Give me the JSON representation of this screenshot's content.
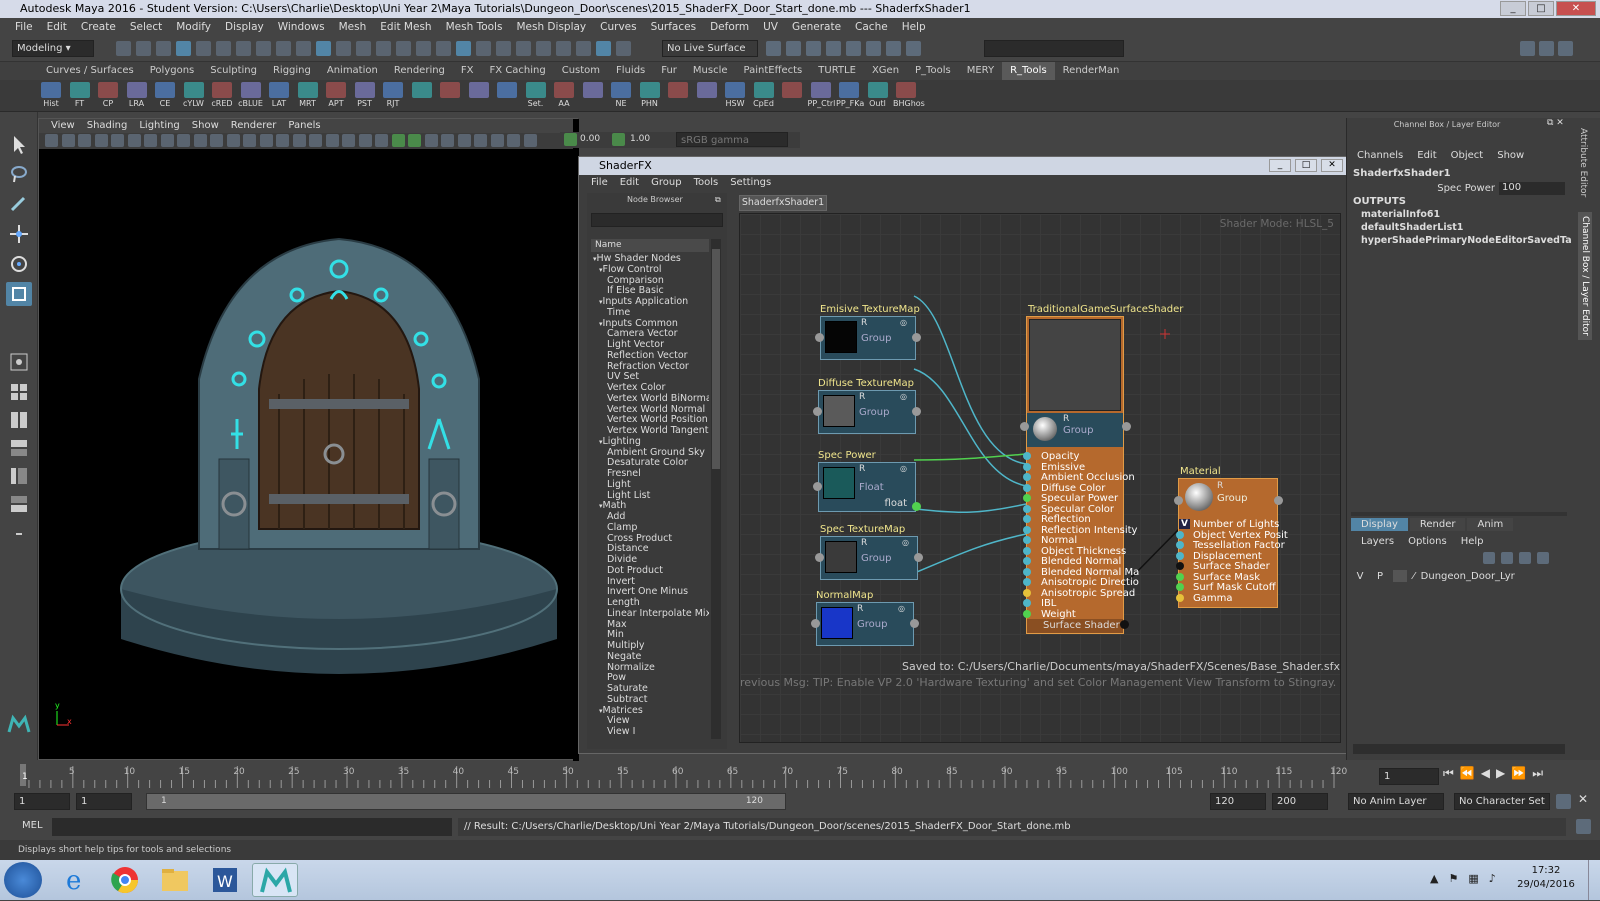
{
  "window": {
    "title": "Autodesk Maya 2016 - Student Version: C:\\Users\\Charlie\\Desktop\\Uni Year 2\\Maya Tutorials\\Dungeon_Door\\scenes\\2015_ShaderFX_Door_Start_done.mb    ---    ShaderfxShader1"
  },
  "menubar": [
    "File",
    "Edit",
    "Create",
    "Select",
    "Modify",
    "Display",
    "Windows",
    "Mesh",
    "Edit Mesh",
    "Mesh Tools",
    "Mesh Display",
    "Curves",
    "Surfaces",
    "Deform",
    "UV",
    "Generate",
    "Cache",
    "Help"
  ],
  "statusline": {
    "menuset": "Modeling",
    "live_surface": "No Live Surface"
  },
  "shelf_tabs": [
    "Curves / Surfaces",
    "Polygons",
    "Sculpting",
    "Rigging",
    "Animation",
    "Rendering",
    "FX",
    "FX Caching",
    "Custom",
    "Fluids",
    "Fur",
    "Muscle",
    "PaintEffects",
    "TURTLE",
    "XGen",
    "P_Tools",
    "MERY",
    "R_Tools",
    "RenderMan"
  ],
  "shelf_tools": [
    "Hist",
    "FT",
    "CP",
    "LRA",
    "CE",
    "cYLW",
    "cRED",
    "cBLUE",
    "LAT",
    "MRT",
    "APT",
    "PST",
    "RJT",
    "",
    "",
    "",
    "",
    "Set.",
    "AA",
    "",
    "NE",
    "PHN",
    "",
    "",
    "HSW",
    "CpEd",
    "",
    "PP_Ctrl",
    "PP_FKa",
    "Outl",
    "BHGhos"
  ],
  "viewport": {
    "menu": [
      "View",
      "Shading",
      "Lighting",
      "Show",
      "Renderer",
      "Panels"
    ],
    "exposure": "0.00",
    "gamma": "1.00",
    "colorspace": "sRGB gamma",
    "axis_y": "y",
    "axis_x": "x"
  },
  "shaderfx": {
    "title": "ShaderFX",
    "menu": [
      "File",
      "Edit",
      "Group",
      "Tools",
      "Settings"
    ],
    "node_browser_label": "Node Browser",
    "tab": "ShaderfxShader1",
    "shader_mode": "Shader Mode: HLSL_5",
    "tree_header": "Name",
    "tree": [
      "Hw Shader Nodes",
      "Flow Control",
      "Comparison",
      "If Else Basic",
      "Inputs Application",
      "Time",
      "Inputs Common",
      "Camera Vector",
      "Light Vector",
      "Reflection Vector",
      "Refraction Vector",
      "UV Set",
      "Vertex Color",
      "Vertex World BiNormal",
      "Vertex World Normal",
      "Vertex World Position",
      "Vertex World Tangent",
      "Lighting",
      "Ambient Ground Sky",
      "Desaturate Color",
      "Fresnel",
      "Light",
      "Light List",
      "Math",
      "Add",
      "Clamp",
      "Cross Product",
      "Distance",
      "Divide",
      "Dot Product",
      "Invert",
      "Invert One Minus",
      "Length",
      "Linear Interpolate Mix",
      "Max",
      "Min",
      "Multiply",
      "Negate",
      "Normalize",
      "Pow",
      "Saturate",
      "Subtract",
      "Matrices",
      "View",
      "View I"
    ],
    "tree_levels": [
      0,
      1,
      2,
      2,
      1,
      2,
      1,
      2,
      2,
      2,
      2,
      2,
      2,
      2,
      2,
      2,
      2,
      1,
      2,
      2,
      2,
      2,
      2,
      1,
      2,
      2,
      2,
      2,
      2,
      2,
      2,
      2,
      2,
      2,
      2,
      2,
      2,
      2,
      2,
      2,
      2,
      2,
      1,
      2,
      2
    ],
    "nodes": [
      {
        "title": "Emisive TextureMap",
        "label": "Group",
        "r": "R"
      },
      {
        "title": "Diffuse TextureMap",
        "label": "Group",
        "r": "R"
      },
      {
        "title": "Spec Power",
        "label": "Float",
        "r": "R",
        "out": "float"
      },
      {
        "title": "Spec TextureMap",
        "label": "Group",
        "r": "R"
      },
      {
        "title": "NormalMap",
        "label": "Group",
        "r": "R"
      }
    ],
    "main_node": {
      "title": "TraditionalGameSurfaceShader",
      "label": "Group",
      "r": "R",
      "inputs": [
        "Opacity",
        "Emissive",
        "Ambient Occlusion",
        "Diffuse Color",
        "Specular Power",
        "Specular Color",
        "Reflection",
        "Reflection Intensity",
        "Normal",
        "Object Thickness",
        "Blended Normal",
        "Blended Normal Ma",
        "Anisotropic Directio",
        "Anisotropic Spread",
        "IBL",
        "Weight"
      ],
      "output": "Surface Shader"
    },
    "material_node": {
      "title": "Material",
      "label": "Group",
      "r": "R",
      "inputs": [
        "Number of Lights",
        "Object Vertex Posit",
        "Tessellation Factor",
        "Displacement",
        "Surface Shader",
        "Surface Mask",
        "Surf Mask Cutoff",
        "Gamma"
      ],
      "v": "V"
    },
    "saved": "Saved to: C:/Users/Charlie/Documents/maya/ShaderFX/Scenes/Base_Shader.sfx",
    "prev_msg": "revious Msg: TIP: Enable VP 2.0 'Hardware Texturing' and set Color Management View Transform to Stingray."
  },
  "channelbox": {
    "title": "Channel Box / Layer Editor",
    "menu": [
      "Channels",
      "Edit",
      "Object",
      "Show"
    ],
    "object": "ShaderfxShader1",
    "attr": {
      "name": "Spec Power",
      "value": "100"
    },
    "outputs_label": "OUTPUTS",
    "outputs": [
      "materialInfo61",
      "defaultShaderList1",
      "hyperShadePrimaryNodeEditorSavedTabsInfo"
    ],
    "layer_tabs": [
      "Display",
      "Render",
      "Anim"
    ],
    "layer_menu": [
      "Layers",
      "Options",
      "Help"
    ],
    "layer": {
      "v": "V",
      "p": "P",
      "name": "Dungeon_Door_Lyr"
    },
    "side_tabs": [
      "Attribute Editor",
      "Channel Box / Layer Editor"
    ]
  },
  "timeline": {
    "ticks": [
      "5",
      "10",
      "15",
      "20",
      "25",
      "30",
      "35",
      "40",
      "45",
      "50",
      "55",
      "60",
      "65",
      "70",
      "75",
      "80",
      "85",
      "90",
      "95",
      "100",
      "105",
      "110",
      "115",
      "120"
    ],
    "current": "1",
    "end_label": "120",
    "frame_field": "1"
  },
  "range": {
    "start": "1",
    "start2": "1",
    "slider_start": "1",
    "slider_end": "120",
    "end": "120",
    "end2": "200",
    "anim_layer": "No Anim Layer",
    "char_set": "No Character Set"
  },
  "cmdline": {
    "label": "MEL",
    "result": "// Result: C:/Users/Charlie/Desktop/Uni Year 2/Maya Tutorials/Dungeon_Door/scenes/2015_ShaderFX_Door_Start_done.mb"
  },
  "helpline": "Displays short help tips for tools and selections",
  "taskbar": {
    "time": "17:32",
    "date": "29/04/2016"
  },
  "colors": {
    "accent": "#5285a6",
    "node_blue": "#294b5b",
    "node_orange": "#b5692d",
    "title_yellow": "#f0e58c",
    "wire": "#4fb6c9"
  }
}
